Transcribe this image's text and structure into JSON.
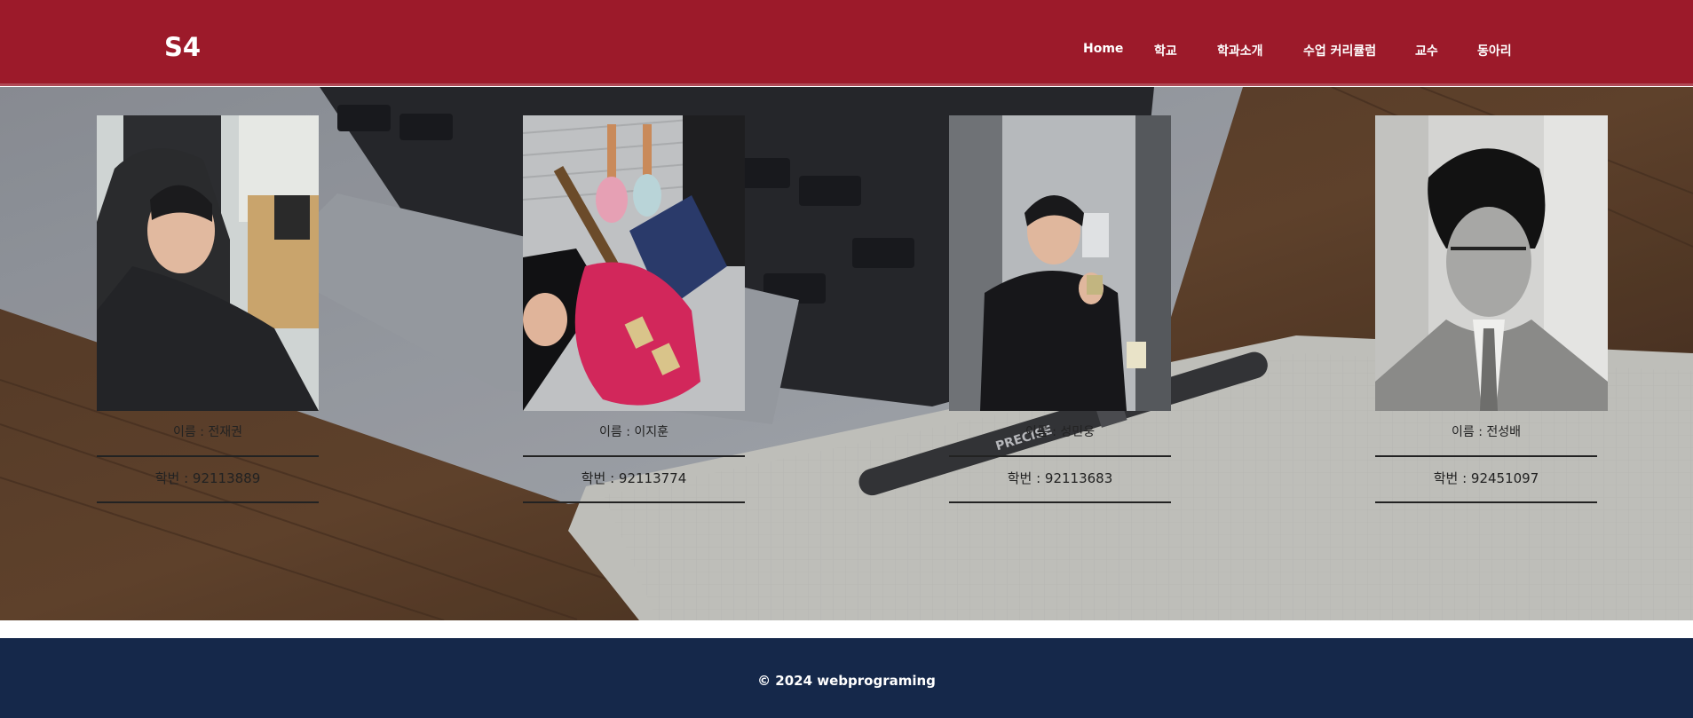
{
  "header": {
    "logo": "S4",
    "nav": [
      {
        "label": "Home"
      },
      {
        "label": "학교"
      },
      {
        "label": "학과소개"
      },
      {
        "label": "수업 커리큘럼"
      },
      {
        "label": "교수"
      },
      {
        "label": "동아리"
      }
    ]
  },
  "members": [
    {
      "name": "이름 : 전재권",
      "student_id": "학번 : 92113889"
    },
    {
      "name": "이름 : 이지훈",
      "student_id": "학번 : 92113774"
    },
    {
      "name": "이름 : 성민웅",
      "student_id": "학번 : 92113683"
    },
    {
      "name": "이름 : 전성배",
      "student_id": "학번 : 92451097"
    }
  ],
  "footer": {
    "text": "© 2024 webprograming"
  },
  "colors": {
    "header_bg": "#9c1a2a",
    "footer_bg": "#15284a"
  }
}
